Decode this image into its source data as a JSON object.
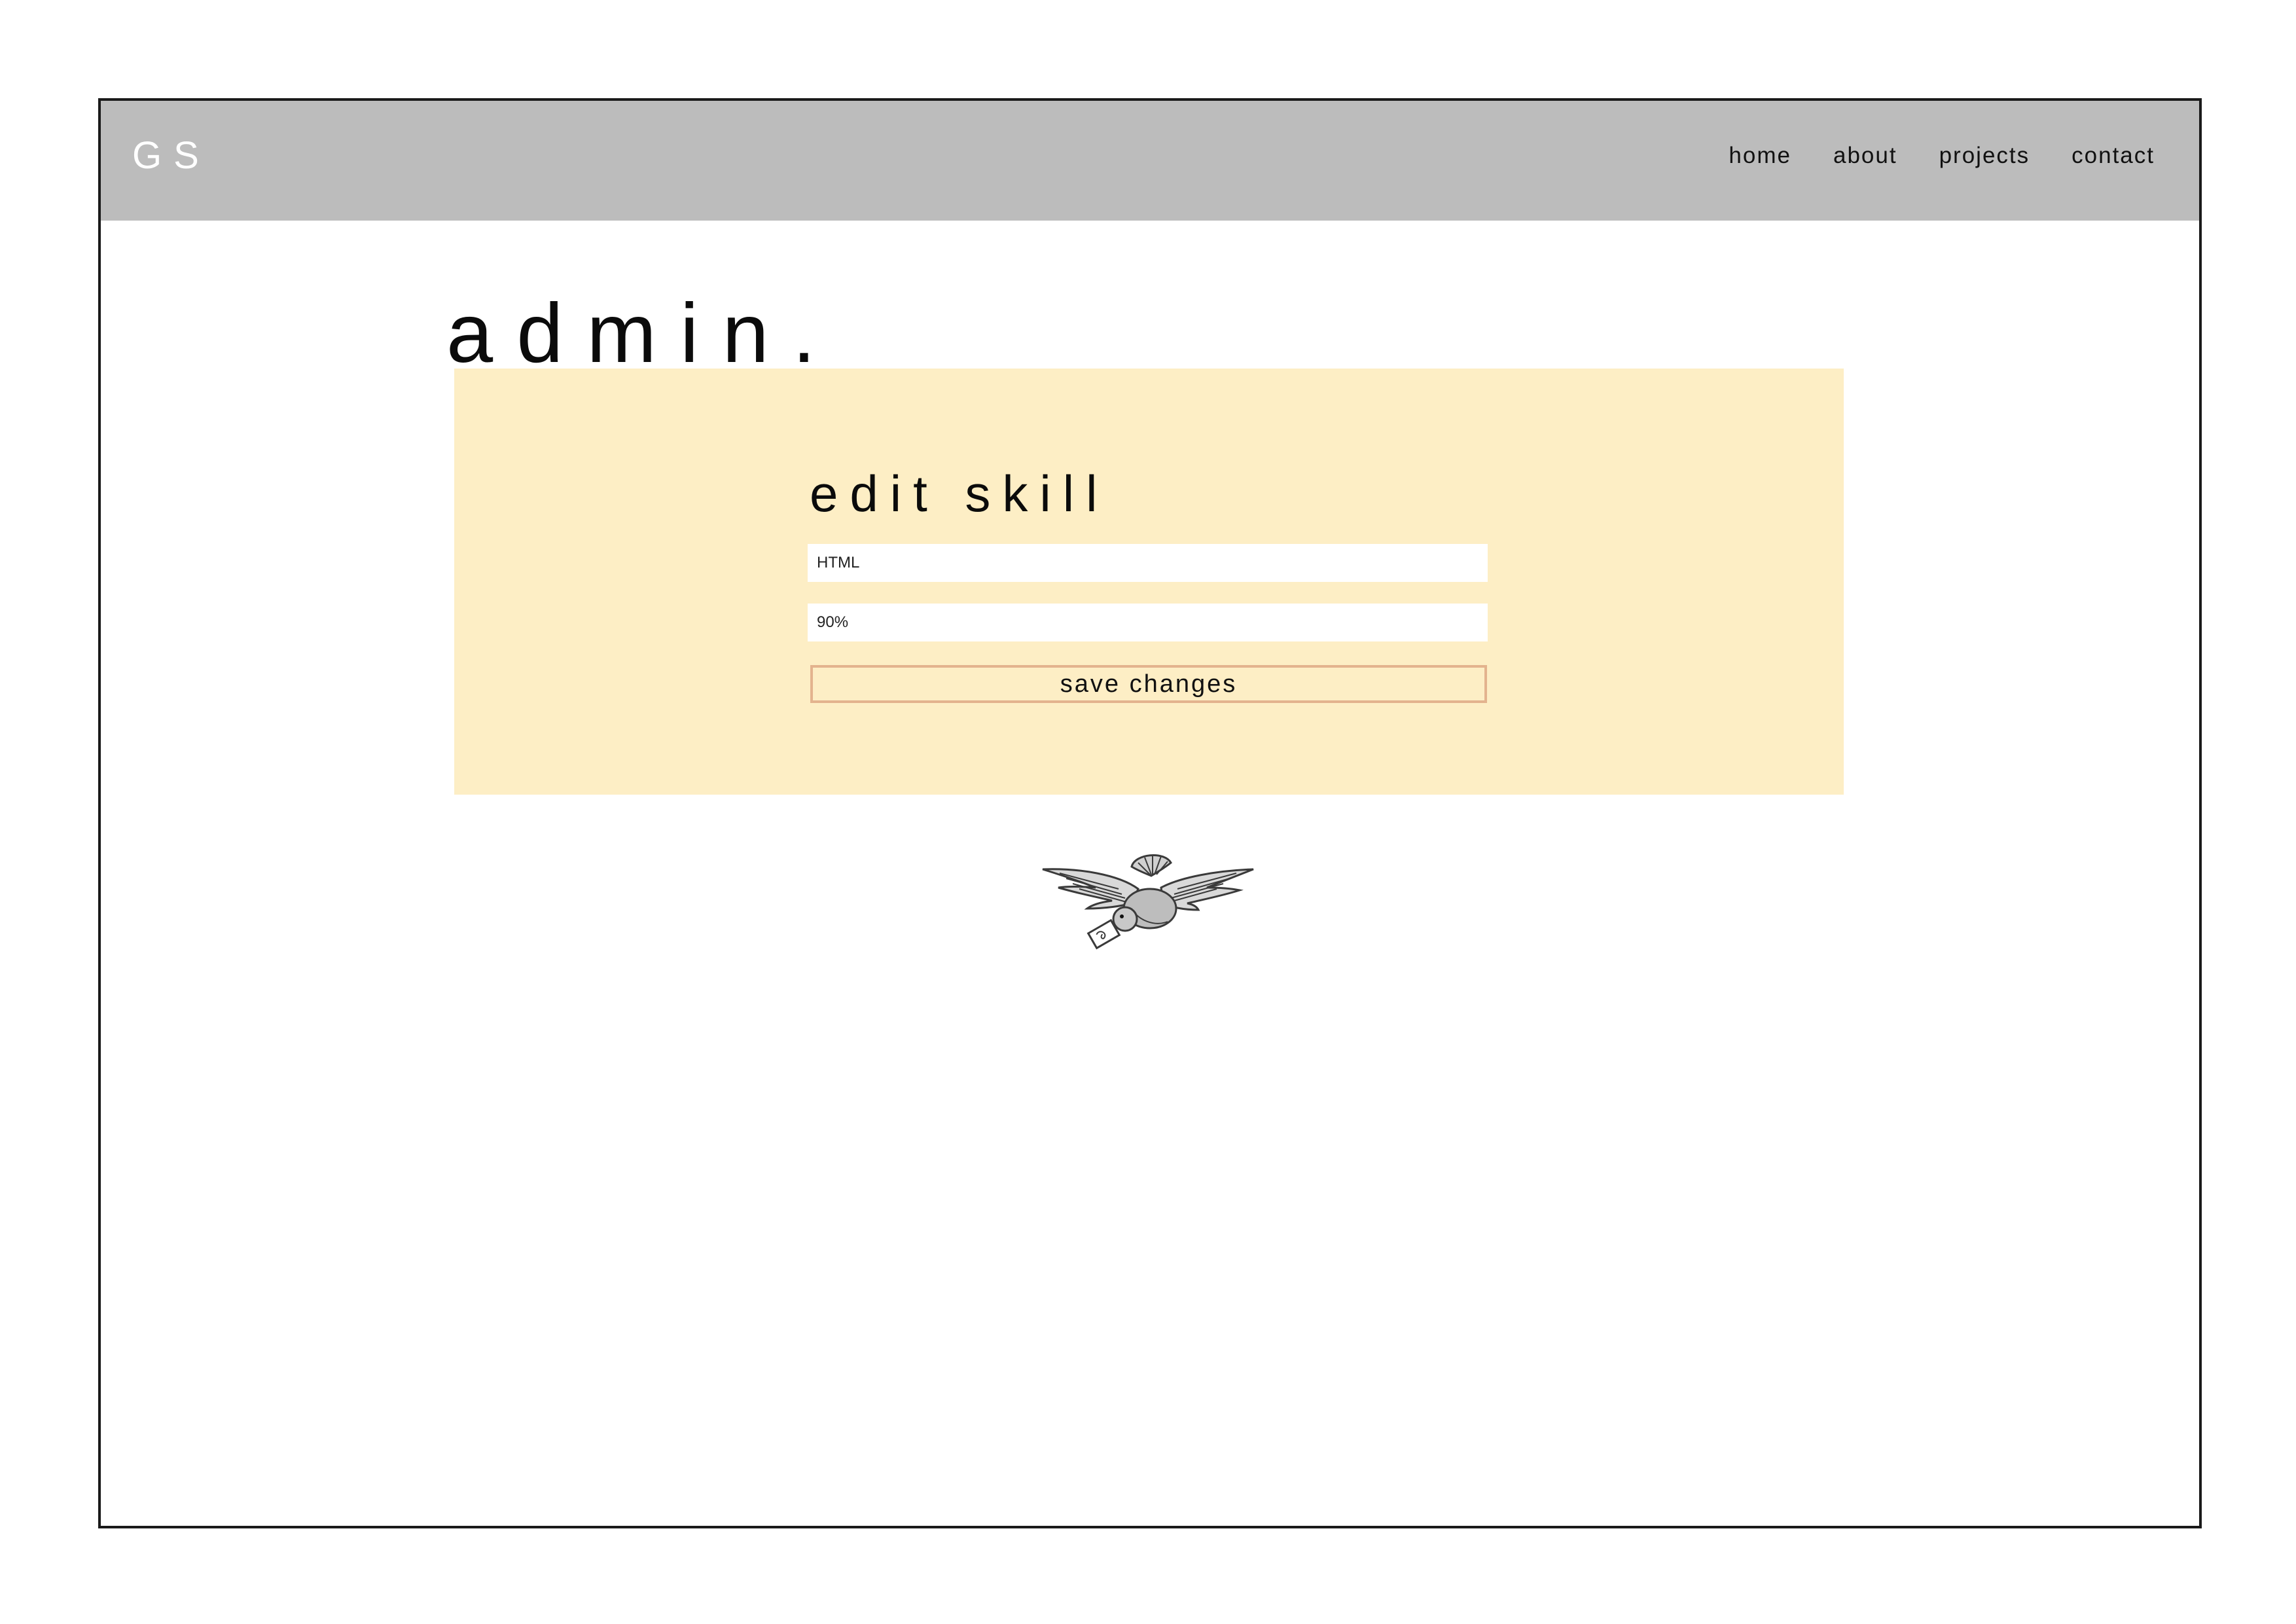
{
  "header": {
    "logo": "GS",
    "nav": [
      "home",
      "about",
      "projects",
      "contact"
    ]
  },
  "page": {
    "title": "admin."
  },
  "form": {
    "heading": "edit skill",
    "name_value": "HTML",
    "level_value": "90%",
    "save_label": "save changes"
  },
  "icons": {
    "decoration": "bird-carrying-letter-icon"
  },
  "colors": {
    "navbar": "#bcbcbc",
    "panel": "#fdeec5",
    "button_border": "#e3b38e"
  }
}
